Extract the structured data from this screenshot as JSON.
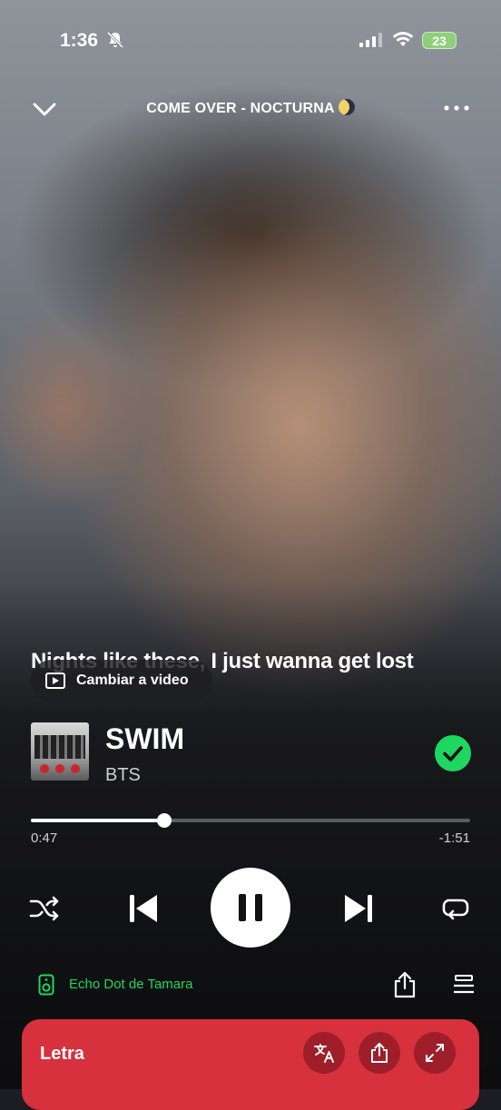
{
  "status_bar": {
    "time": "1:36",
    "battery": "23"
  },
  "header": {
    "title": "COME OVER - NOCTURNA"
  },
  "lyric": {
    "current_line": "Nights like these, I just wanna get lost"
  },
  "video_toggle": {
    "label": "Cambiar a video"
  },
  "track": {
    "title": "SWIM",
    "artist": "BTS"
  },
  "progress": {
    "elapsed": "0:47",
    "remaining": "-1:51",
    "fraction": 0.303
  },
  "device": {
    "name": "Echo Dot de Tamara"
  },
  "lyrics_card": {
    "label": "Letra"
  },
  "colors": {
    "accent_green": "#1ed760",
    "lyrics_card_red": "#d6313c"
  },
  "icons": [
    "bell-slash-icon",
    "signal-icon",
    "wifi-icon",
    "battery-icon",
    "chevron-down-icon",
    "moon-emoji",
    "more-icon",
    "video-icon",
    "check-icon",
    "shuffle-icon",
    "previous-icon",
    "pause-icon",
    "next-icon",
    "repeat-icon",
    "speaker-icon",
    "share-icon",
    "queue-icon",
    "translate-icon",
    "expand-icon"
  ]
}
